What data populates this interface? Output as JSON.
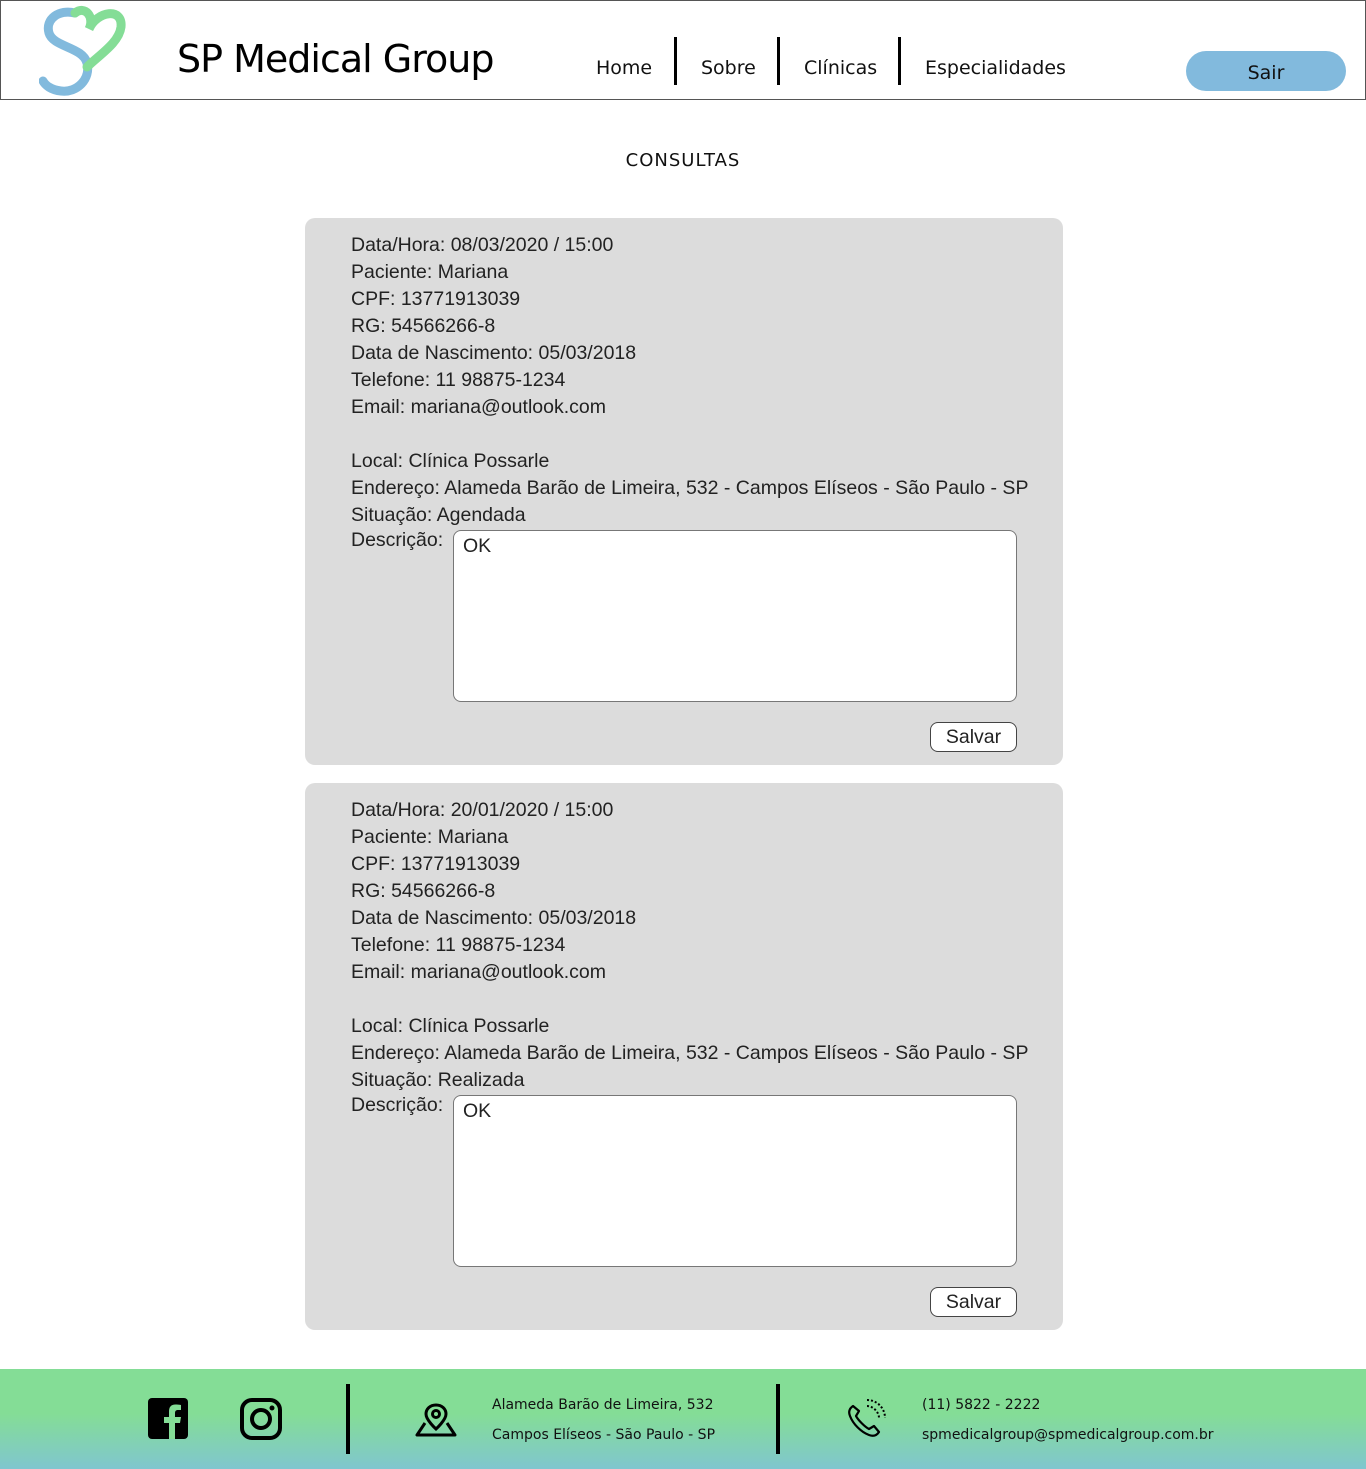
{
  "header": {
    "brand": "SP Medical Group",
    "nav": [
      "Home",
      "Sobre",
      "Clínicas",
      "Especialidades"
    ],
    "logout_label": "Sair",
    "logout_color": "#82badd"
  },
  "page": {
    "title": "CONSULTAS"
  },
  "consultas": [
    {
      "datahora": "Data/Hora: 08/03/2020 / 15:00",
      "paciente": "Paciente: Mariana",
      "cpf": "CPF: 13771913039",
      "rg": "RG: 54566266-8",
      "nascimento": "Data de Nascimento: 05/03/2018",
      "telefone": "Telefone: 11 98875-1234",
      "email": "Email: mariana@outlook.com",
      "local": "Local: Clínica Possarle",
      "endereco": "Endereço: Alameda Barão de Limeira, 532 - Campos Elíseos - São Paulo - SP",
      "situacao": "Situação: Agendada",
      "descricao_label": "Descrição:",
      "descricao": "OK",
      "save_label": "Salvar"
    },
    {
      "datahora": "Data/Hora: 20/01/2020 / 15:00",
      "paciente": "Paciente: Mariana",
      "cpf": "CPF: 13771913039",
      "rg": "RG: 54566266-8",
      "nascimento": "Data de Nascimento: 05/03/2018",
      "telefone": "Telefone: 11 98875-1234",
      "email": "Email: mariana@outlook.com",
      "local": "Local: Clínica Possarle",
      "endereco": "Endereço: Alameda Barão de Limeira, 532 - Campos Elíseos - São Paulo - SP",
      "situacao": "Situação: Realizada",
      "descricao_label": "Descrição:",
      "descricao": "OK",
      "save_label": "Salvar"
    }
  ],
  "footer": {
    "address_line1": "Alameda Barão de Limeira, 532",
    "address_line2": "Campos Elíseos - São Paulo - SP",
    "phone": "(11) 5822 - 2222",
    "email": "spmedicalgroup@spmedicalgroup.com.br",
    "icons": [
      "facebook-icon",
      "instagram-icon",
      "map-pin-icon",
      "phone-icon"
    ]
  }
}
